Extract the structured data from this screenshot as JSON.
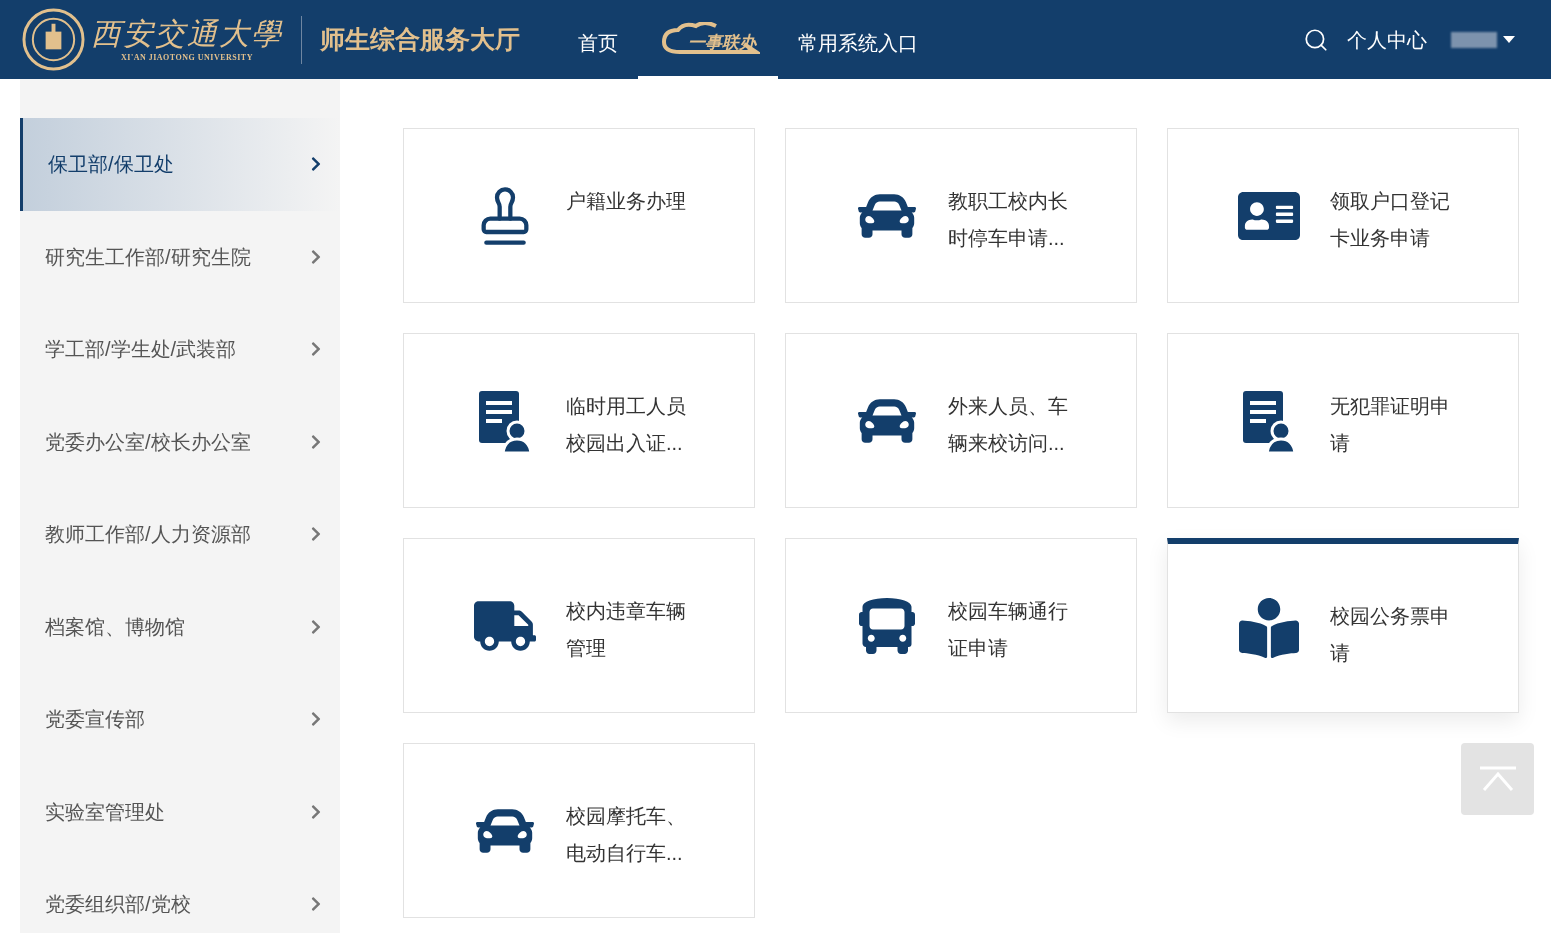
{
  "header": {
    "logo_cn": "西安交通大學",
    "logo_en": "XI'AN JIAOTONG UNIVERSITY",
    "title": "师生综合服务大厅",
    "nav": [
      {
        "label": "首页",
        "kind": "text",
        "selected": false
      },
      {
        "label": "一事联办",
        "kind": "cloud",
        "selected": true
      },
      {
        "label": "常用系统入口",
        "kind": "text",
        "selected": false
      }
    ],
    "user_menu": "个人中心"
  },
  "sidebar": {
    "items": [
      {
        "label": "保卫部/保卫处",
        "selected": true
      },
      {
        "label": "研究生工作部/研究生院",
        "selected": false
      },
      {
        "label": "学工部/学生处/武装部",
        "selected": false
      },
      {
        "label": "党委办公室/校长办公室",
        "selected": false
      },
      {
        "label": "教师工作部/人力资源部",
        "selected": false
      },
      {
        "label": "档案馆、博物馆",
        "selected": false
      },
      {
        "label": "党委宣传部",
        "selected": false
      },
      {
        "label": "实验室管理处",
        "selected": false
      },
      {
        "label": "党委组织部/党校",
        "selected": false
      }
    ]
  },
  "services": [
    {
      "lines": [
        "户籍业务办理"
      ],
      "kind": "stamp",
      "selected": false
    },
    {
      "lines": [
        "教职工校内长",
        "时停车申请..."
      ],
      "kind": "car",
      "selected": false
    },
    {
      "lines": [
        "领取户口登记",
        "卡业务申请"
      ],
      "kind": "idcard",
      "selected": false
    },
    {
      "lines": [
        "临时用工人员",
        "校园出入证..."
      ],
      "kind": "document",
      "selected": false
    },
    {
      "lines": [
        "外来人员、车",
        "辆来校访问..."
      ],
      "kind": "car",
      "selected": false
    },
    {
      "lines": [
        "无犯罪证明申",
        "请"
      ],
      "kind": "document",
      "selected": false
    },
    {
      "lines": [
        "校内违章车辆",
        "管理"
      ],
      "kind": "truck",
      "selected": false
    },
    {
      "lines": [
        "校园车辆通行",
        "证申请"
      ],
      "kind": "bus",
      "selected": false
    },
    {
      "lines": [
        "校园公务票申",
        "请"
      ],
      "kind": "reader",
      "selected": true
    },
    {
      "lines": [
        "校园摩托车、",
        "电动自行车..."
      ],
      "kind": "car",
      "selected": false
    }
  ]
}
